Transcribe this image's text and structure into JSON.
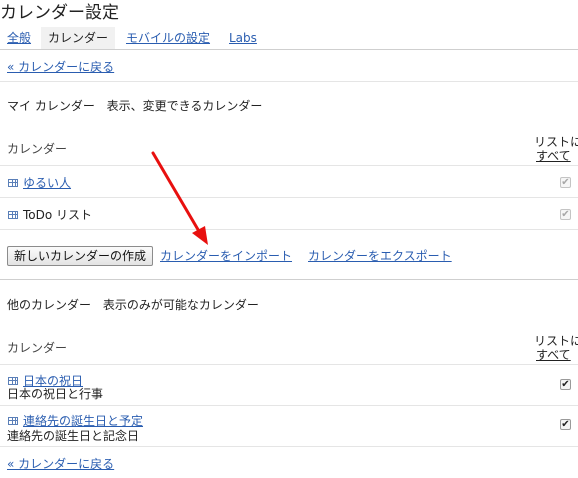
{
  "page": {
    "title": "カレンダー設定"
  },
  "tabs": [
    {
      "label": "全般",
      "selected": false
    },
    {
      "label": "カレンダー",
      "selected": true
    },
    {
      "label": "モバイルの設定",
      "selected": false
    },
    {
      "label": "Labs",
      "selected": false
    }
  ],
  "back_link": "« カレンダーに戻る",
  "my_calendars": {
    "title": "マイ カレンダー",
    "description": "表示、変更できるカレンダー",
    "column_header": "カレンダー",
    "list_header": "リストに",
    "list_all": "すべて",
    "items": [
      {
        "name": "ゆるい人",
        "is_link": true,
        "checked": true,
        "disabled": true
      },
      {
        "name": "ToDo リスト",
        "is_link": false,
        "checked": true,
        "disabled": true
      }
    ],
    "create_button": "新しいカレンダーの作成",
    "import_link": "カレンダーをインポート",
    "export_link": "カレンダーをエクスポート"
  },
  "other_calendars": {
    "title": "他のカレンダー",
    "description": "表示のみが可能なカレンダー",
    "column_header": "カレンダー",
    "list_header": "リストに",
    "list_all": "すべて",
    "items": [
      {
        "name": "日本の祝日",
        "subtitle": "日本の祝日と行事",
        "checked": true
      },
      {
        "name": "連絡先の誕生日と予定",
        "subtitle": "連絡先の誕生日と記念日",
        "checked": true
      }
    ]
  },
  "icons": {
    "calendar_item": "calendar-grid-icon",
    "annotation": "red-arrow"
  },
  "colors": {
    "link": "#2a5db0",
    "arrow": "#e8100f"
  }
}
